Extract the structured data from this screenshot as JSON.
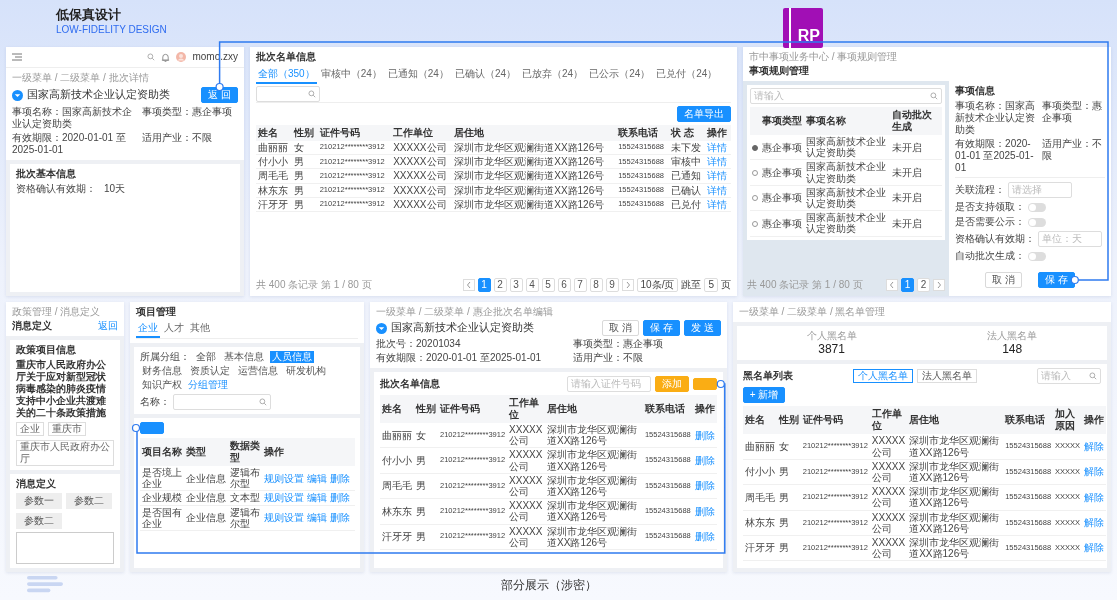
{
  "header": {
    "title": "低保真设计",
    "subtitle": "LOW-FIDELITY DESIGN"
  },
  "logo": {
    "text": "RP"
  },
  "screens": [
    {
      "kind": "batch_detail",
      "user": "momo.zxy",
      "breadcrumb": "一级菜单 / 二级菜单 / 批次详情",
      "title": "国家高新技术企业认定资助类",
      "back_button": "返 回",
      "fields": [
        "事项名称：国家高新技术企业认定资助类",
        "事项类型：惠企事项",
        "有效期限：2020-01-01 至2025-01-01",
        "适用产业：不限"
      ],
      "card": {
        "title": "批次基本信息",
        "label": "资格确认有效期：",
        "value": "10天"
      }
    },
    {
      "kind": "batch_list",
      "title": "批次名单信息",
      "tabs": [
        {
          "label": "全部（350）",
          "selected": true
        },
        {
          "label": "审核中（24）",
          "selected": false
        },
        {
          "label": "已通知（24）",
          "selected": false
        },
        {
          "label": "已确认（24）",
          "selected": false
        },
        {
          "label": "已放弃（24）",
          "selected": false
        },
        {
          "label": "已公示（24）",
          "selected": false
        },
        {
          "label": "已兑付（24）",
          "selected": false
        }
      ],
      "export_button": "名单导出",
      "table": {
        "columns": [
          "姓名",
          "性别",
          "证件号码",
          "工作单位",
          "居住地",
          "联系电话",
          "状 态",
          "操作"
        ],
        "rows": [
          {
            "cells": [
              "曲丽丽",
              "女",
              "210212********3912",
              "XXXXX公司",
              "深圳市龙华区观澜街道XX路126号",
              "15524315688",
              "未下发"
            ],
            "action": "详情"
          },
          {
            "cells": [
              "付小小",
              "男",
              "210212********3912",
              "XXXXX公司",
              "深圳市龙华区观澜街道XX路126号",
              "15524315688",
              "审核中"
            ],
            "action": "详情"
          },
          {
            "cells": [
              "周毛毛",
              "男",
              "210212********3912",
              "XXXXX公司",
              "深圳市龙华区观澜街道XX路126号",
              "15524315688",
              "已通知"
            ],
            "action": "详情"
          },
          {
            "cells": [
              "林东东",
              "男",
              "210212********3912",
              "XXXXX公司",
              "深圳市龙华区观澜街道XX路126号",
              "15524315688",
              "已确认"
            ],
            "action": "详情"
          },
          {
            "cells": [
              "汗牙牙",
              "男",
              "210212********3912",
              "XXXXX公司",
              "深圳市龙华区观澜街道XX路126号",
              "15524315688",
              "已兑付"
            ],
            "action": "详情"
          }
        ]
      },
      "pagination": {
        "summary": "共 400 条记录 第 1 / 80 页",
        "pages": [
          {
            "label": "1",
            "selected": true
          },
          {
            "label": "2",
            "selected": false
          },
          {
            "label": "3",
            "selected": false
          },
          {
            "label": "4",
            "selected": false
          },
          {
            "label": "5",
            "selected": false
          },
          {
            "label": "6",
            "selected": false
          },
          {
            "label": "7",
            "selected": false
          },
          {
            "label": "8",
            "selected": false
          },
          {
            "label": "9",
            "selected": false
          }
        ],
        "page_size": "10条/页",
        "jump_label": "跳至",
        "jump_value": "5",
        "jump_unit": "页"
      }
    },
    {
      "kind": "rule_manager",
      "breadcrumb": "市中事项业务中心 / 事项规则管理",
      "title": "事项规则管理",
      "search": {
        "placeholder": "请输入"
      },
      "table": {
        "columns": [
          "事项类型",
          "事项名称",
          "自动批次生成"
        ],
        "rows": [
          {
            "selected": true,
            "cells": [
              "惠企事项",
              "国家高新技术企业认定资助类",
              "未开启"
            ]
          },
          {
            "selected": false,
            "cells": [
              "惠企事项",
              "国家高新技术企业认定资助类",
              "未开启"
            ]
          },
          {
            "selected": false,
            "cells": [
              "惠企事项",
              "国家高新技术企业认定资助类",
              "未开启"
            ]
          },
          {
            "selected": false,
            "cells": [
              "惠企事项",
              "国家高新技术企业认定资助类",
              "未开启"
            ]
          }
        ]
      },
      "pagination": {
        "summary": "共 400 条记录 第 1 / 80 页",
        "pages": [
          {
            "label": "1",
            "selected": true
          },
          {
            "label": "2",
            "selected": false
          }
        ]
      },
      "info_title": "事项信息",
      "fields": [
        "事项名称：国家高新技术企业认定资助类",
        "事项类型：惠企事项",
        "有效期限：2020-01-01 至2025-01-01",
        "适用产业：不限"
      ],
      "form": [
        {
          "kind": "select",
          "label": "关联流程：",
          "placeholder": "请选择"
        },
        {
          "kind": "toggle",
          "label": "是否支持领取：",
          "on": false
        },
        {
          "kind": "toggle",
          "label": "是否需要公示：",
          "on": false
        },
        {
          "kind": "input",
          "label": "资格确认有效期：",
          "placeholder": "单位：天"
        },
        {
          "kind": "toggle",
          "label": "自动批次生成：",
          "on": false
        }
      ],
      "buttons": [
        {
          "label": "取 消",
          "primary": false
        },
        {
          "label": "保 存",
          "primary": true
        }
      ]
    },
    {
      "kind": "message_definition",
      "breadcrumb": "政策管理 / 消息定义",
      "title": "消息定义",
      "back_link": "返回",
      "card_title": "政策项目信息",
      "policy": "重庆市人民政府办公厅关于应对新型冠状病毒感染的肺炎疫情支持中小企业共渡难关的二十条政策措施",
      "tags": [
        "企业",
        "重庆市",
        "重庆市人民政府办公厅"
      ],
      "section_title": "消息定义",
      "params": [
        "参数一",
        "参数二",
        "参数二"
      ]
    },
    {
      "kind": "project_manager",
      "title": "项目管理",
      "tabs": [
        {
          "label": "企业",
          "selected": true
        },
        {
          "label": "人才",
          "selected": false
        },
        {
          "label": "其他",
          "selected": false
        }
      ],
      "group_label": "所属分组：",
      "groups": [
        {
          "label": "全部",
          "selected": false
        },
        {
          "label": "基本信息",
          "selected": false
        },
        {
          "label": "人员信息",
          "selected": true
        },
        {
          "label": "财务信息",
          "selected": false
        },
        {
          "label": "资质认定",
          "selected": false
        },
        {
          "label": "运营信息",
          "selected": false
        },
        {
          "label": "研发机构",
          "selected": false
        },
        {
          "label": "知识产权",
          "selected": false
        }
      ],
      "group_link": "分组管理",
      "name_label": "名称：",
      "table": {
        "columns": [
          "项目名称",
          "类型",
          "数据类型",
          "操作"
        ],
        "rows": [
          {
            "cells": [
              "是否境上企业",
              "企业信息",
              "逻辑布尔型"
            ],
            "actions": [
              "规则设置",
              "编辑",
              "删除"
            ]
          },
          {
            "cells": [
              "企业规模",
              "企业信息",
              "文本型"
            ],
            "actions": [
              "规则设置",
              "编辑",
              "删除"
            ]
          },
          {
            "cells": [
              "是否国有企业",
              "企业信息",
              "逻辑布尔型"
            ],
            "actions": [
              "规则设置",
              "编辑",
              "删除"
            ]
          }
        ]
      }
    },
    {
      "kind": "batch_edit",
      "breadcrumb": "一级菜单 / 二级菜单 / 惠企批次名单编辑",
      "title": "国家高新技术企业认定资助类",
      "buttons": [
        {
          "label": "取 消",
          "primary": false
        },
        {
          "label": "保 存",
          "primary": true
        },
        {
          "label": "发 送",
          "primary": true
        }
      ],
      "fields": [
        "批次号：20201034",
        "事项类型：惠企事项",
        "有效期限：2020-01-01 至2025-01-01",
        "适用产业：不限"
      ],
      "card_title": "批次名单信息",
      "id_input": {
        "placeholder": "请输入证件号码"
      },
      "add_button": "添加",
      "table": {
        "columns": [
          "姓名",
          "性别",
          "证件号码",
          "工作单位",
          "居住地",
          "联系电话",
          "操作"
        ],
        "rows": [
          {
            "cells": [
              "曲丽丽",
              "女",
              "210212********3912",
              "XXXXX公司",
              "深圳市龙华区观澜街道XX路126号",
              "15524315688"
            ],
            "action": "删除"
          },
          {
            "cells": [
              "付小小",
              "男",
              "210212********3912",
              "XXXXX公司",
              "深圳市龙华区观澜街道XX路126号",
              "15524315688"
            ],
            "action": "删除"
          },
          {
            "cells": [
              "周毛毛",
              "男",
              "210212********3912",
              "XXXXX公司",
              "深圳市龙华区观澜街道XX路126号",
              "15524315688"
            ],
            "action": "删除"
          },
          {
            "cells": [
              "林东东",
              "男",
              "210212********3912",
              "XXXXX公司",
              "深圳市龙华区观澜街道XX路126号",
              "15524315688"
            ],
            "action": "删除"
          },
          {
            "cells": [
              "汗牙牙",
              "男",
              "210212********3912",
              "XXXXX公司",
              "深圳市龙华区观澜街道XX路126号",
              "15524315688"
            ],
            "action": "删除"
          }
        ]
      }
    },
    {
      "kind": "blacklist",
      "breadcrumb": "一级菜单 / 二级菜单 / 黑名单管理",
      "stats": [
        {
          "label": "个人黑名单",
          "value": "3871"
        },
        {
          "label": "法人黑名单",
          "value": "148"
        }
      ],
      "list_title": "黑名单列表",
      "switch": [
        {
          "label": "个人黑名单",
          "selected": true
        },
        {
          "label": "法人黑名单",
          "selected": false
        }
      ],
      "search": {
        "placeholder": "请输入"
      },
      "new_button": "+ 新增",
      "table": {
        "columns": [
          "姓名",
          "性别",
          "证件号码",
          "工作单位",
          "居住地",
          "联系电话",
          "加入原因",
          "操作"
        ],
        "rows": [
          {
            "cells": [
              "曲丽丽",
              "女",
              "210212********3912",
              "XXXXX公司",
              "深圳市龙华区观澜街道XX路126号",
              "15524315688",
              "XXXXX"
            ],
            "action": "解除"
          },
          {
            "cells": [
              "付小小",
              "男",
              "210212********3912",
              "XXXXX公司",
              "深圳市龙华区观澜街道XX路126号",
              "15524315688",
              "XXXXX"
            ],
            "action": "解除"
          },
          {
            "cells": [
              "周毛毛",
              "男",
              "210212********3912",
              "XXXXX公司",
              "深圳市龙华区观澜街道XX路126号",
              "15524315688",
              "XXXXX"
            ],
            "action": "解除"
          },
          {
            "cells": [
              "林东东",
              "男",
              "210212********3912",
              "XXXXX公司",
              "深圳市龙华区观澜街道XX路126号",
              "15524315688",
              "XXXXX"
            ],
            "action": "解除"
          },
          {
            "cells": [
              "汗牙牙",
              "男",
              "210212********3912",
              "XXXXX公司",
              "深圳市龙华区观澜街道XX路126号",
              "15524315688",
              "XXXXX"
            ],
            "action": "解除"
          }
        ]
      }
    }
  ],
  "caption": "部分展示（涉密）"
}
